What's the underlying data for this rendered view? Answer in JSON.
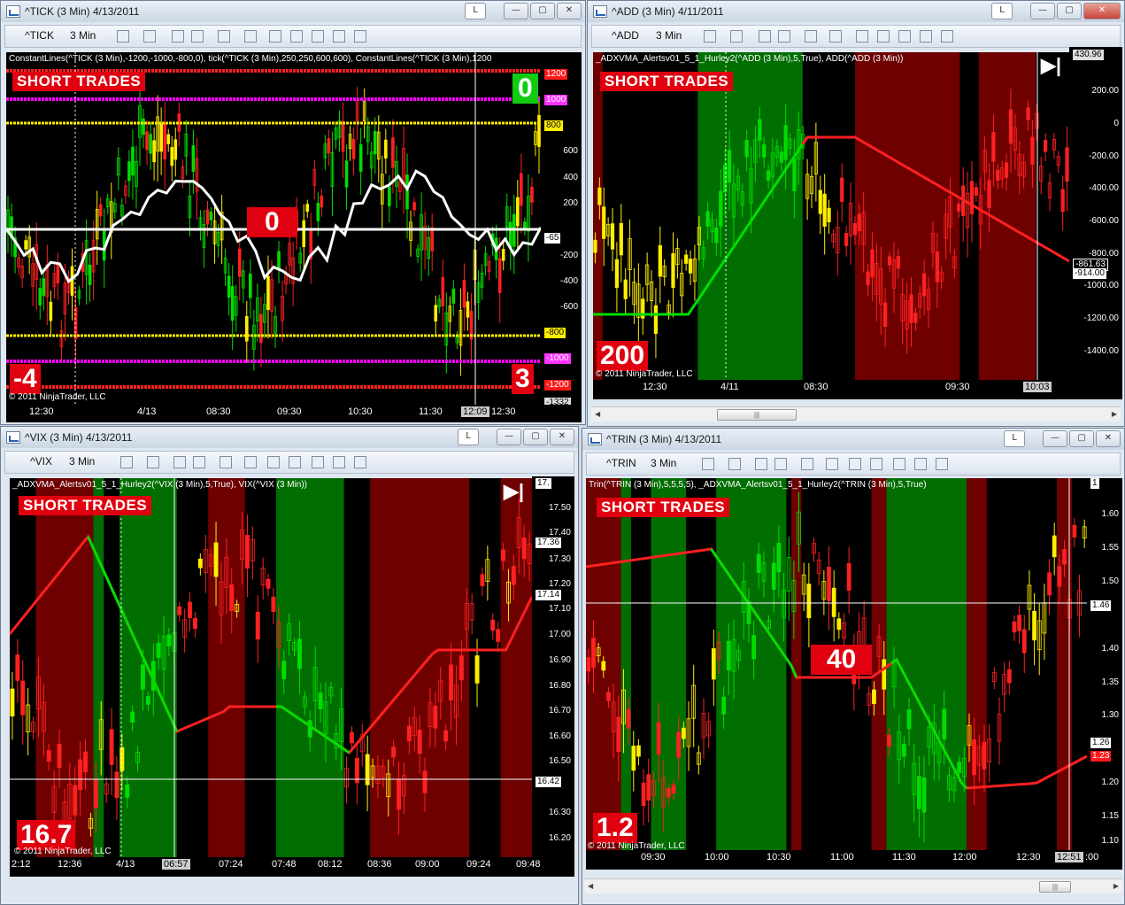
{
  "windows": {
    "tick": {
      "title": "^TICK (3 Min)  4/13/2011",
      "btn_l": "L",
      "toolbar": {
        "instrument": "^TICK",
        "interval": "3 Min"
      },
      "header": "ConstantLines(^TICK (3 Min),-1200,-1000,-800,0), tick(^TICK (3 Min),250,250,600,600), ConstantLines(^TICK (3 Min),1200",
      "short_label": "SHORT TRADES",
      "box_top_right": "0",
      "box_center": "0",
      "box_bottom_left": "-4",
      "box_bottom_right": "3",
      "copyright": "© 2011 NinjaTrader, LLC",
      "y_labels": [
        "600",
        "400",
        "200",
        "-200",
        "-400",
        "-600"
      ],
      "tags": {
        "p1200": "1200",
        "p1000": "1000",
        "p800": "800",
        "cur": "-65",
        "n800": "-800",
        "n1000": "-1000",
        "n1200": "-1200",
        "low": "-1332"
      },
      "x_labels": [
        "12:30",
        "4/13",
        "08:30",
        "09:30",
        "10:30",
        "11:30",
        "12:30"
      ],
      "x_cursor": "12:09"
    },
    "add": {
      "title": "^ADD (3 Min)  4/11/2011",
      "btn_l": "L",
      "toolbar": {
        "instrument": "^ADD",
        "interval": "3 Min"
      },
      "header": "_ADXVMA_Alertsv01_5_1_Hurley2(^ADD (3 Min),5,True), ADD(^ADD (3 Min))",
      "short_label": "SHORT TRADES",
      "box_bottom_left": "200",
      "copyright": "© 2011 NinjaTrader, LLC",
      "y_labels": [
        "200.00",
        "0",
        "-200.00",
        "-400.00",
        "-600.00",
        "-800.00",
        "-1000.00",
        "-1200.00",
        "-1400.00"
      ],
      "tags": {
        "top": "430.96",
        "a": "-861.63",
        "b": "-914.00"
      },
      "x_labels": [
        "12:30",
        "4/11",
        "08:30",
        "09:30"
      ],
      "x_cursor": "10:03"
    },
    "vix": {
      "title": "^VIX (3 Min)  4/13/2011",
      "btn_l": "L",
      "toolbar": {
        "instrument": "^VIX",
        "interval": "3 Min"
      },
      "header": "_ADXVMA_Alertsv01_5_1_Hurley2(^VIX (3 Min),5,True), VIX(^VIX (3 Min))",
      "short_label": "SHORT TRADES",
      "box_bottom_left": "16.7",
      "copyright": "© 2011 NinjaTrader, LLC",
      "y_labels": [
        "17.50",
        "17.40",
        "17.30",
        "17.20",
        "17.10",
        "17.00",
        "16.90",
        "16.80",
        "16.70",
        "16.60",
        "16.50",
        "16.30",
        "16.20"
      ],
      "tags": {
        "top": "17.",
        "a": "17.36",
        "b": "17.14",
        "c": "16.42"
      },
      "x_labels": [
        "2:12",
        "12:36",
        "4/13",
        "07:24",
        "07:48",
        "08:12",
        "08:36",
        "09:00",
        "09:24",
        "09:48"
      ],
      "x_cursor": "06:57"
    },
    "trin": {
      "title": "^TRIN (3 Min)  4/13/2011",
      "btn_l": "L",
      "toolbar": {
        "instrument": "^TRIN",
        "interval": "3 Min"
      },
      "header": "Trin(^TRIN (3 Min),5,5,5,5), _ADXVMA_Alertsv01_5_1_Hurley2(^TRIN (3 Min),5,True)",
      "short_label": "SHORT TRADES",
      "box_center": "40",
      "box_bottom_left": "1.2",
      "copyright": "© 2011 NinjaTrader, LLC",
      "y_labels": [
        "1.60",
        "1.55",
        "1.50",
        "1.40",
        "1.35",
        "1.30",
        "1.20",
        "1.15",
        "1.10"
      ],
      "tags": {
        "top": "1",
        "a": "1.46",
        "b": "1.26",
        "c": "1.23"
      },
      "x_labels": [
        "09:30",
        "10:00",
        "10:30",
        "11:00",
        "11:30",
        "12:00",
        "12:30"
      ],
      "x_cursor": "12:51",
      "x_end": ":00"
    }
  },
  "colors": {
    "red_zone": "#6e0000",
    "green_zone": "#006e00",
    "up": "#00dd00",
    "down": "#ff2020",
    "neutral": "#ffee00",
    "magenta": "#ff00ff"
  }
}
